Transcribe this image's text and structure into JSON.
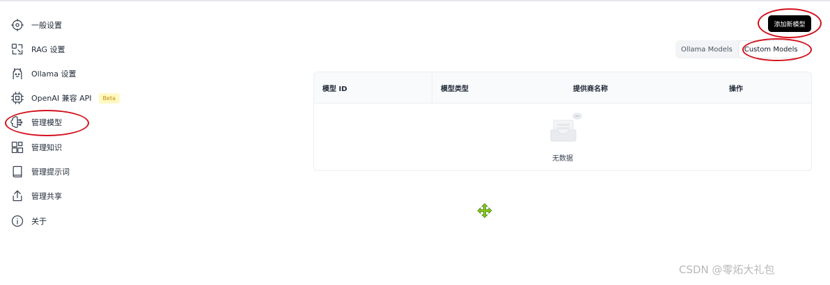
{
  "sidebar": {
    "items": [
      {
        "label": "一般设置",
        "icon": "settings-icon"
      },
      {
        "label": "RAG 设置",
        "icon": "rag-icon"
      },
      {
        "label": "Ollama 设置",
        "icon": "llama-icon"
      },
      {
        "label": "OpenAI 兼容 API",
        "icon": "chip-icon",
        "badge": "Beta"
      },
      {
        "label": "管理模型",
        "icon": "brain-icon",
        "active": true
      },
      {
        "label": "管理知识",
        "icon": "blocks-icon"
      },
      {
        "label": "管理提示词",
        "icon": "book-icon"
      },
      {
        "label": "管理共享",
        "icon": "share-icon"
      },
      {
        "label": "关于",
        "icon": "info-icon"
      }
    ]
  },
  "header": {
    "add_button": "添加新模型",
    "tabs": [
      "Ollama Models",
      "Custom Models"
    ],
    "active_tab": "Custom Models"
  },
  "table": {
    "columns": [
      "模型 ID",
      "模型类型",
      "提供商名称",
      "操作"
    ],
    "empty_text": "无数据"
  },
  "watermark": "CSDN @零炻大礼包",
  "colors": {
    "annotation": "#d40f1c",
    "badge_bg": "#fef9c3",
    "badge_text": "#ca8a04",
    "button_bg": "#000000"
  }
}
